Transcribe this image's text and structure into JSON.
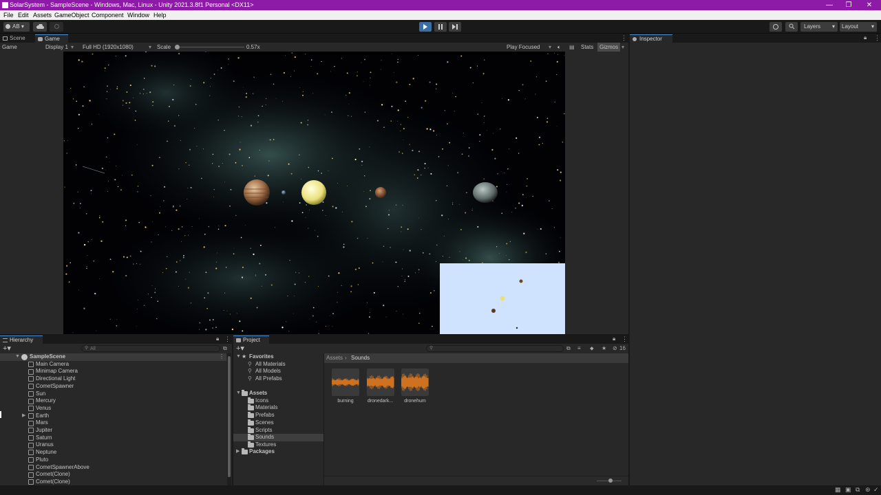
{
  "window": {
    "title": "SolarSystem - SampleScene - Windows, Mac, Linux - Unity 2021.3.8f1 Personal <DX11>",
    "controls": [
      "—",
      "❐",
      "✕"
    ]
  },
  "menu": [
    "File",
    "Edit",
    "Assets",
    "GameObject",
    "Component",
    "Window",
    "Help"
  ],
  "toolbar": {
    "account": "AB ▾",
    "layers": "Layers",
    "layout": "Layout"
  },
  "scene_panel": {
    "tabs": [
      "Scene",
      "Game"
    ],
    "active_tab": "Game",
    "game_bar": {
      "mode": "Game",
      "display": "Display 1",
      "resolution": "Full HD (1920x1080)",
      "scale_label": "Scale",
      "scale_value": "0.57x",
      "play_mode": "Play Focused",
      "stats": "Stats",
      "gizmos": "Gizmos"
    }
  },
  "inspector": {
    "tab": "Inspector"
  },
  "hierarchy": {
    "tab": "Hierarchy",
    "search_placeholder": "All",
    "scene": "SampleScene",
    "items": [
      "Main Camera",
      "Minimap Camera",
      "Directional Light",
      "CometSpawner",
      "Sun",
      "Mercury",
      "Venus",
      "Earth",
      "Mars",
      "Jupiter",
      "Saturn",
      "Uranus",
      "Neptune",
      "Pluto",
      "CometSpawnerAbove",
      "Comet(Clone)",
      "Comet(Clone)"
    ]
  },
  "project": {
    "tab": "Project",
    "favorites_label": "Favorites",
    "favorites": [
      "All Materials",
      "All Models",
      "All Prefabs"
    ],
    "assets_label": "Assets",
    "folders": [
      "Icons",
      "Materials",
      "Prefabs",
      "Scenes",
      "Scripts",
      "Sounds",
      "Textures"
    ],
    "packages_label": "Packages",
    "selected_folder": "Sounds",
    "breadcrumb": [
      "Assets",
      "Sounds"
    ],
    "hidden_count": "16",
    "assets": [
      "burning",
      "dronedark...",
      "dronehum"
    ]
  },
  "colors": {
    "title_bar": "#8e1aa8",
    "accent": "#4a90d9",
    "waveform": "#e0781c",
    "minimap_bg": "#cfe3ff"
  }
}
